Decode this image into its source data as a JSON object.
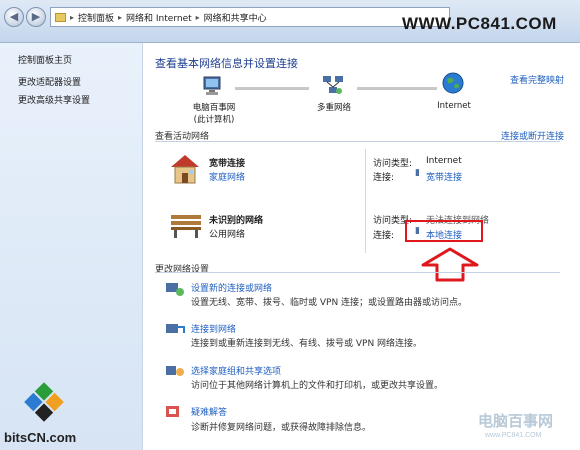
{
  "address_bar": {
    "crumbs": [
      "控制面板",
      "网络和 Internet",
      "网络和共享中心"
    ]
  },
  "watermark_top": "WWW.PC841.COM",
  "sidebar": {
    "items": [
      {
        "label": "控制面板主页"
      },
      {
        "label": "更改适配器设置"
      },
      {
        "label": "更改高级共享设置"
      }
    ]
  },
  "main": {
    "title": "查看基本网络信息并设置连接",
    "see_full_map": "查看完整映射",
    "map_nodes": {
      "computer_line1": "电脑百事网",
      "computer_line2": "(此计算机)",
      "multi_network": "多重网络",
      "internet": "Internet"
    },
    "active_networks": {
      "header": "查看活动网络",
      "connect_link": "连接或断开连接",
      "networks": [
        {
          "name": "宽带连接",
          "type": "家庭网络",
          "access_label": "访问类型:",
          "access_value": "Internet",
          "conn_label": "连接:",
          "conn_value": "宽带连接"
        },
        {
          "name": "未识别的网络",
          "type": "公用网络",
          "access_label": "访问类型:",
          "access_value": "无法连接到网络",
          "conn_label": "连接:",
          "conn_value": "本地连接"
        }
      ]
    },
    "change_settings": {
      "header": "更改网络设置",
      "tasks": [
        {
          "link": "设置新的连接或网络",
          "desc": "设置无线、宽带、拨号、临时或 VPN 连接；或设置路由器或访问点。"
        },
        {
          "link": "连接到网络",
          "desc": "连接到或重新连接到无线、有线、拨号或 VPN 网络连接。"
        },
        {
          "link": "选择家庭组和共享选项",
          "desc": "访问位于其他网络计算机上的文件和打印机，或更改共享设置。"
        },
        {
          "link": "疑难解答",
          "desc": "诊断并修复网络问题，或获得故障排除信息。"
        }
      ]
    }
  },
  "watermark_bits": "bitsCN.com",
  "watermark_pc841": "电脑百事网",
  "watermark_pc841_small": "www.PC841.COM",
  "colors": {
    "accent": "#2060c0",
    "highlight": "#e0181e"
  }
}
